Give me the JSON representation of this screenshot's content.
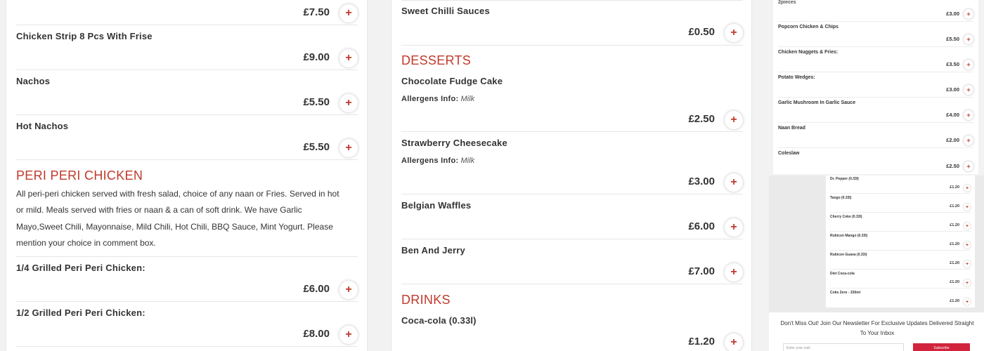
{
  "accent_color": "#c0392b",
  "add_icon": "plus-icon",
  "col1": {
    "items": [
      {
        "price": "£7.50"
      },
      {
        "name": "Chicken Strip 8 Pcs With Frise",
        "price": "£9.00"
      },
      {
        "name": "Nachos",
        "price": "£5.50"
      },
      {
        "name": "Hot Nachos",
        "price": "£5.50"
      }
    ],
    "category": "PERI PERI CHICKEN",
    "category_desc": "All peri-peri chicken served with fresh salad, choice of any naan or Fries. Served in hot or mild. Meals served with fries or naan & a can of soft drink. We have Garlic Mayo,Sweet Chili, Mayonnaise, Mild Chili, Hot Chili, BBQ Sauce, Mint Yogurt. Please mention your choice in comment box.",
    "items2": [
      {
        "name": "1/4 Grilled Peri Peri Chicken:",
        "price": "£6.00"
      },
      {
        "name": "1/2 Grilled Peri Peri Chicken:",
        "price": "£8.00"
      }
    ]
  },
  "col2": {
    "item0": {
      "name": "Sweet Chilli Sauces",
      "price": "£0.50"
    },
    "desserts_title": "DESSERTS",
    "allergens_label": "Allergens Info:",
    "desserts": [
      {
        "name": "Chocolate Fudge Cake",
        "allergen": "Milk",
        "price": "£2.50"
      },
      {
        "name": "Strawberry Cheesecake",
        "allergen": "Milk",
        "price": "£3.00"
      },
      {
        "name": "Belgian Waffles",
        "price": "£6.00"
      },
      {
        "name": "Ben And Jerry",
        "price": "£7.00"
      }
    ],
    "drinks_title": "DRINKS",
    "drinks": [
      {
        "name": "Coca-cola (0.33l)",
        "price": "£1.20"
      }
    ]
  },
  "right": {
    "top_note": "2pieces",
    "items": [
      {
        "name": "",
        "price": "£3.00"
      },
      {
        "name": "Popcorn Chicken & Chips",
        "price": "£5.50"
      },
      {
        "name": "Chicken Nuggets & Fries:",
        "price": "£3.50"
      },
      {
        "name": "Potato Wedges:",
        "price": "£3.00"
      },
      {
        "name": "Garlic Mushroom In Garlic Sauce",
        "price": "£4.00"
      },
      {
        "name": "Naan Bread",
        "price": "£2.00"
      },
      {
        "name": "Coleslaw",
        "price": "£2.50"
      }
    ],
    "drinks": [
      {
        "name": "Dr. Pepper (0.33l)",
        "price": "£1.20"
      },
      {
        "name": "Tango (0.33l)",
        "price": "£1.20"
      },
      {
        "name": "Cherry Coke (0.33l)",
        "price": "£1.20"
      },
      {
        "name": "Rubicon Mango (0.33l)",
        "price": "£1.20"
      },
      {
        "name": "Rubicon Guava (0.33l)",
        "price": "£1.20"
      },
      {
        "name": "Diet Coca-cola",
        "price": "£1.20"
      },
      {
        "name": "Coke Zero - 330ml",
        "price": "£1.20"
      }
    ],
    "newsletter_text": "Don't Miss Out! Join Our Newsletter For Exclusive Updates Delivered Straight To Your Inbox",
    "newsletter_placeholder": "Enter your mail",
    "subscribe_label": "Subscribe"
  },
  "plus_glyph": "+"
}
